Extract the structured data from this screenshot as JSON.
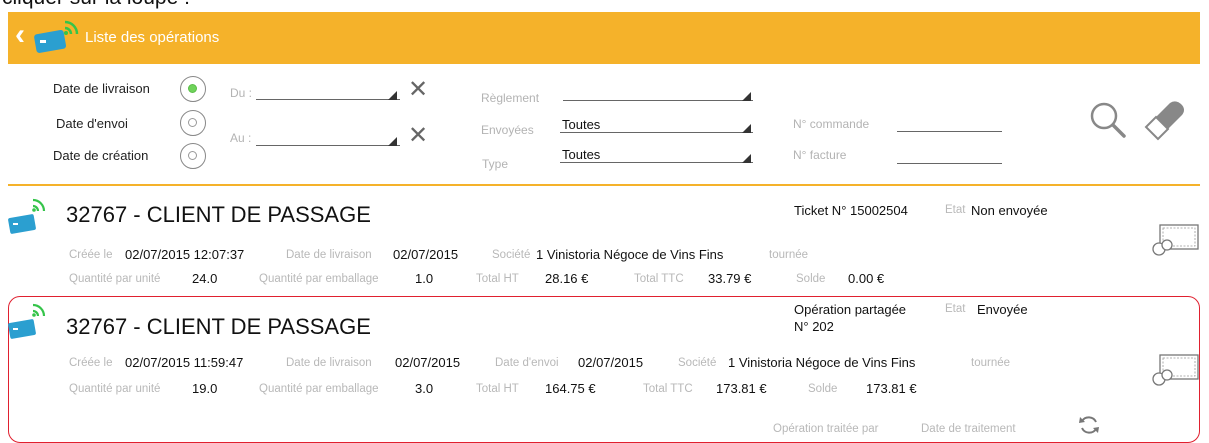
{
  "caption": "cliquer sur la loupe :",
  "header": {
    "title": "Liste des opérations"
  },
  "filters": {
    "date_options": [
      "Date de livraison",
      "Date d'envoi",
      "Date de création"
    ],
    "du_label": "Du :",
    "au_label": "Au :",
    "reglement_label": "Règlement",
    "envoyees_label": "Envoyées",
    "envoyees_value": "Toutes",
    "type_label": "Type",
    "type_value": "Toutes",
    "commande_label": "N° commande",
    "facture_label": "N° facture"
  },
  "operations": [
    {
      "client": "32767 - CLIENT DE PASSAGE",
      "ticket": "Ticket N° 15002504",
      "etat_label": "Etat",
      "etat": "Non envoyée",
      "creee_label": "Créée le",
      "creee": "02/07/2015 12:07:37",
      "livraison_label": "Date de livraison",
      "livraison": "02/07/2015",
      "societe_label": "Société",
      "societe": "1 Vinistoria Négoce de Vins Fins",
      "tournee_label": "tournée",
      "qte_unite_label": "Quantité par unité",
      "qte_unite": "24.0",
      "qte_emb_label": "Quantité par emballage",
      "qte_emb": "1.0",
      "total_ht_label": "Total HT",
      "total_ht": "28.16 €",
      "total_ttc_label": "Total TTC",
      "total_ttc": "33.79 €",
      "solde_label": "Solde",
      "solde": "0.00 €"
    },
    {
      "client": "32767 - CLIENT DE PASSAGE",
      "ticket_line1": "Opération partagée",
      "ticket_line2": "N° 202",
      "etat_label": "Etat",
      "etat": "Envoyée",
      "creee_label": "Créée le",
      "creee": "02/07/2015 11:59:47",
      "livraison_label": "Date de livraison",
      "livraison": "02/07/2015",
      "envoi_label": "Date d'envoi",
      "envoi": "02/07/2015",
      "societe_label": "Société",
      "societe": "1 Vinistoria Négoce de Vins Fins",
      "tournee_label": "tournée",
      "qte_unite_label": "Quantité par unité",
      "qte_unite": "19.0",
      "qte_emb_label": "Quantité par emballage",
      "qte_emb": "3.0",
      "total_ht_label": "Total HT",
      "total_ht": "164.75 €",
      "total_ttc_label": "Total TTC",
      "total_ttc": "173.81 €",
      "solde_label": "Solde",
      "solde": "173.81 €",
      "traitee_label": "Opération traitée par",
      "traitement_label": "Date de traitement"
    }
  ],
  "colors": {
    "accent": "#f5b22a",
    "selected_border": "#e0202f",
    "card_icon": "#2b9fd0",
    "radio_on": "#6fd35a"
  },
  "icons": [
    "back-chevron-icon",
    "nfc-card-icon",
    "search-icon",
    "eraser-icon",
    "attachment-icon",
    "sync-icon",
    "clear-x-icon"
  ]
}
